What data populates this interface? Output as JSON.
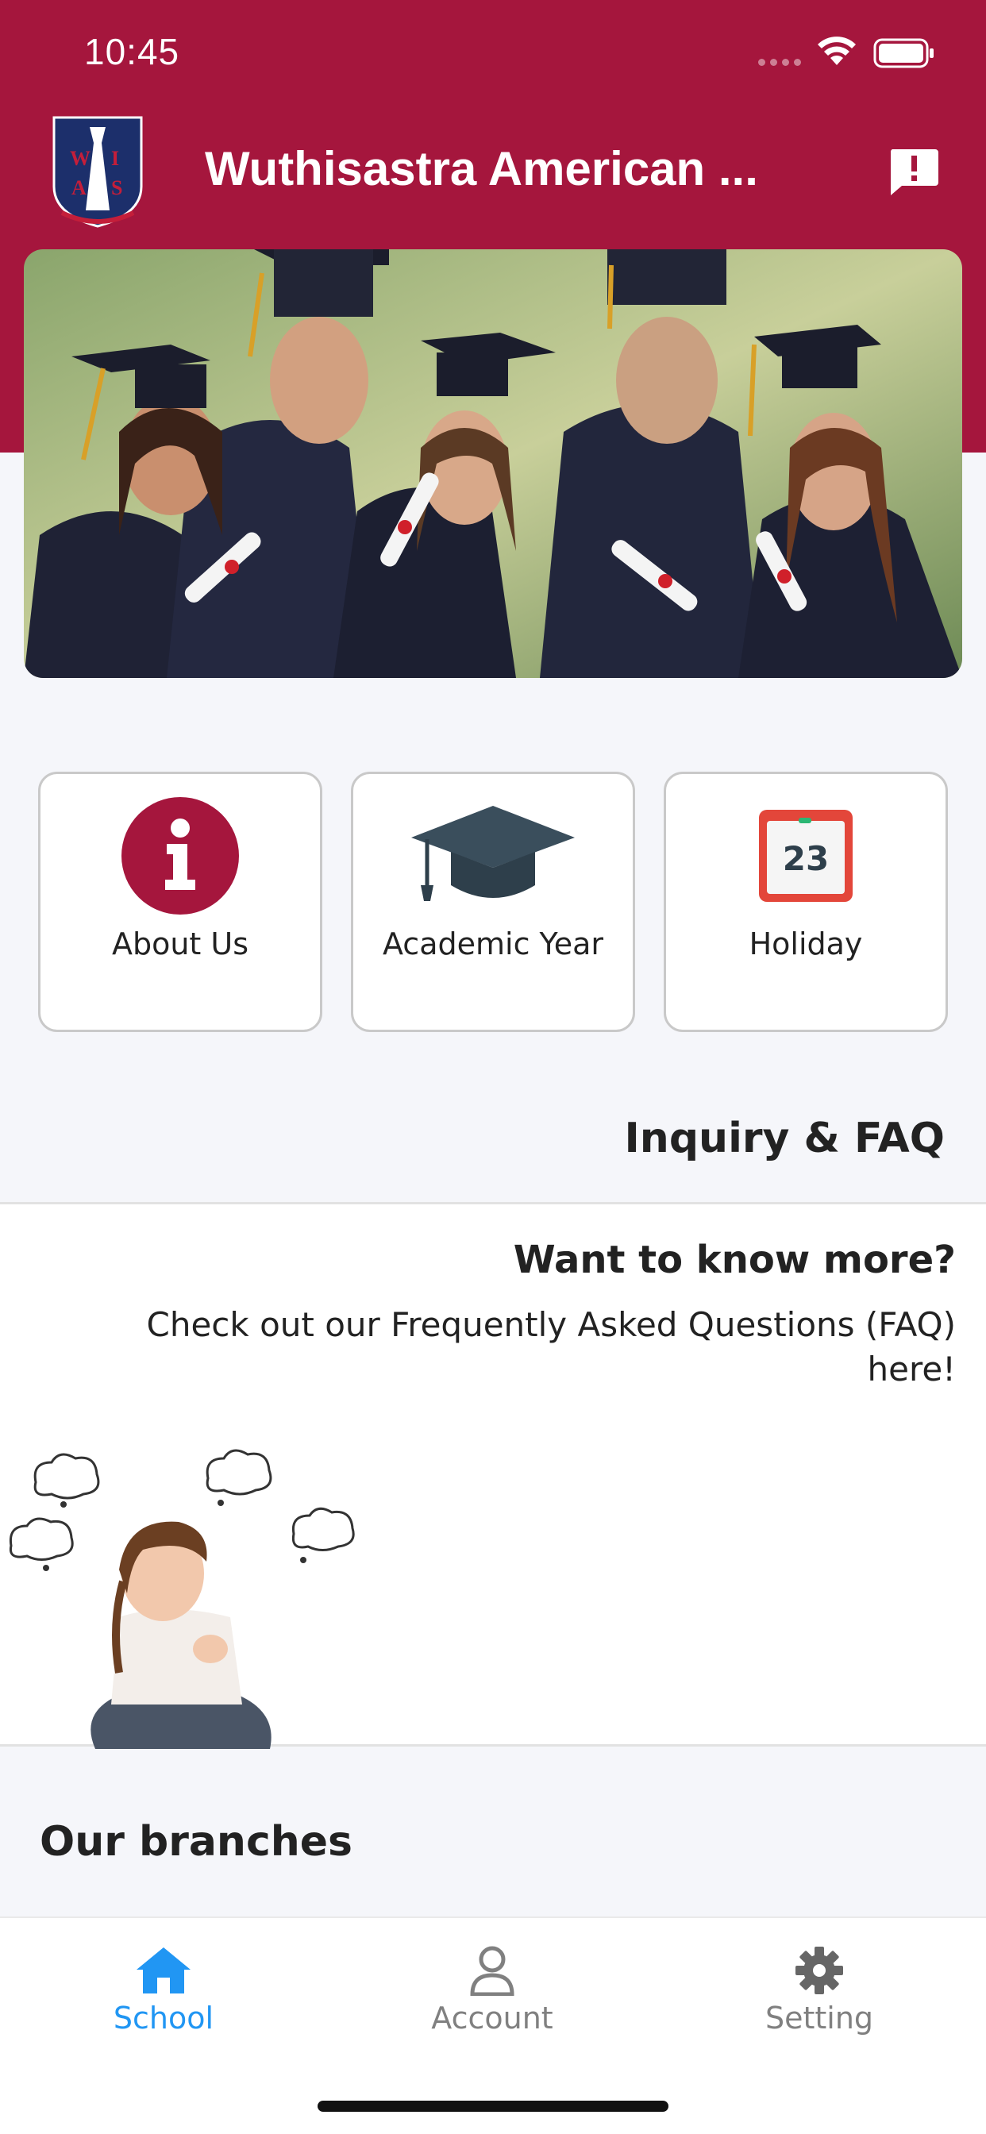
{
  "status_bar": {
    "time": "10:45"
  },
  "app_bar": {
    "title": "Wuthisastra American ...",
    "logo_text": "WAIS"
  },
  "quick_links": [
    {
      "label": "About Us",
      "icon": "info-icon"
    },
    {
      "label": "Academic Year",
      "icon": "graduation-cap-icon"
    },
    {
      "label": "Holiday",
      "icon": "calendar-icon",
      "calendar_day": "23"
    }
  ],
  "inquiry": {
    "title": "Inquiry & FAQ",
    "heading": "Want to know more?",
    "text": "Check out our Frequently Asked Questions (FAQ) here!"
  },
  "branches": {
    "title": "Our branches"
  },
  "tab_bar": {
    "tabs": [
      {
        "label": "School",
        "icon": "home-icon",
        "active": true
      },
      {
        "label": "Account",
        "icon": "person-icon",
        "active": false
      },
      {
        "label": "Setting",
        "icon": "gear-icon",
        "active": false
      }
    ]
  },
  "colors": {
    "brand": "#a5163d",
    "active_tab": "#2196f3",
    "inactive_tab": "#808080"
  }
}
